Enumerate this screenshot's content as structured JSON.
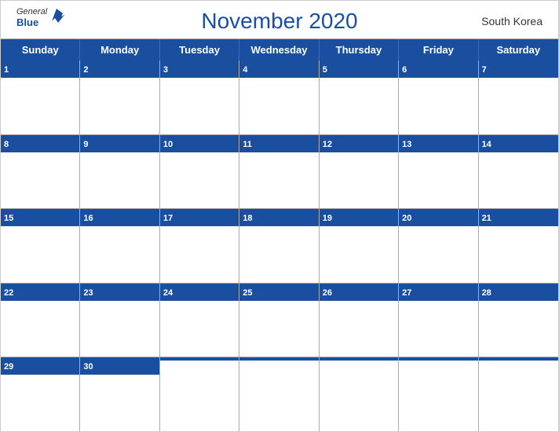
{
  "header": {
    "title": "November 2020",
    "region": "South Korea",
    "logo": {
      "general": "General",
      "blue": "Blue"
    }
  },
  "weekdays": [
    "Sunday",
    "Monday",
    "Tuesday",
    "Wednesday",
    "Thursday",
    "Friday",
    "Saturday"
  ],
  "weeks": [
    [
      {
        "date": 1,
        "empty": false
      },
      {
        "date": 2,
        "empty": false
      },
      {
        "date": 3,
        "empty": false
      },
      {
        "date": 4,
        "empty": false
      },
      {
        "date": 5,
        "empty": false
      },
      {
        "date": 6,
        "empty": false
      },
      {
        "date": 7,
        "empty": false
      }
    ],
    [
      {
        "date": 8,
        "empty": false
      },
      {
        "date": 9,
        "empty": false
      },
      {
        "date": 10,
        "empty": false
      },
      {
        "date": 11,
        "empty": false
      },
      {
        "date": 12,
        "empty": false
      },
      {
        "date": 13,
        "empty": false
      },
      {
        "date": 14,
        "empty": false
      }
    ],
    [
      {
        "date": 15,
        "empty": false
      },
      {
        "date": 16,
        "empty": false
      },
      {
        "date": 17,
        "empty": false
      },
      {
        "date": 18,
        "empty": false
      },
      {
        "date": 19,
        "empty": false
      },
      {
        "date": 20,
        "empty": false
      },
      {
        "date": 21,
        "empty": false
      }
    ],
    [
      {
        "date": 22,
        "empty": false
      },
      {
        "date": 23,
        "empty": false
      },
      {
        "date": 24,
        "empty": false
      },
      {
        "date": 25,
        "empty": false
      },
      {
        "date": 26,
        "empty": false
      },
      {
        "date": 27,
        "empty": false
      },
      {
        "date": 28,
        "empty": false
      }
    ],
    [
      {
        "date": 29,
        "empty": false
      },
      {
        "date": 30,
        "empty": false
      },
      {
        "date": null,
        "empty": true
      },
      {
        "date": null,
        "empty": true
      },
      {
        "date": null,
        "empty": true
      },
      {
        "date": null,
        "empty": true
      },
      {
        "date": null,
        "empty": true
      }
    ]
  ],
  "colors": {
    "primary": "#1a4fa0",
    "border": "#aaa",
    "text_light": "#fff",
    "text_dark": "#333"
  }
}
